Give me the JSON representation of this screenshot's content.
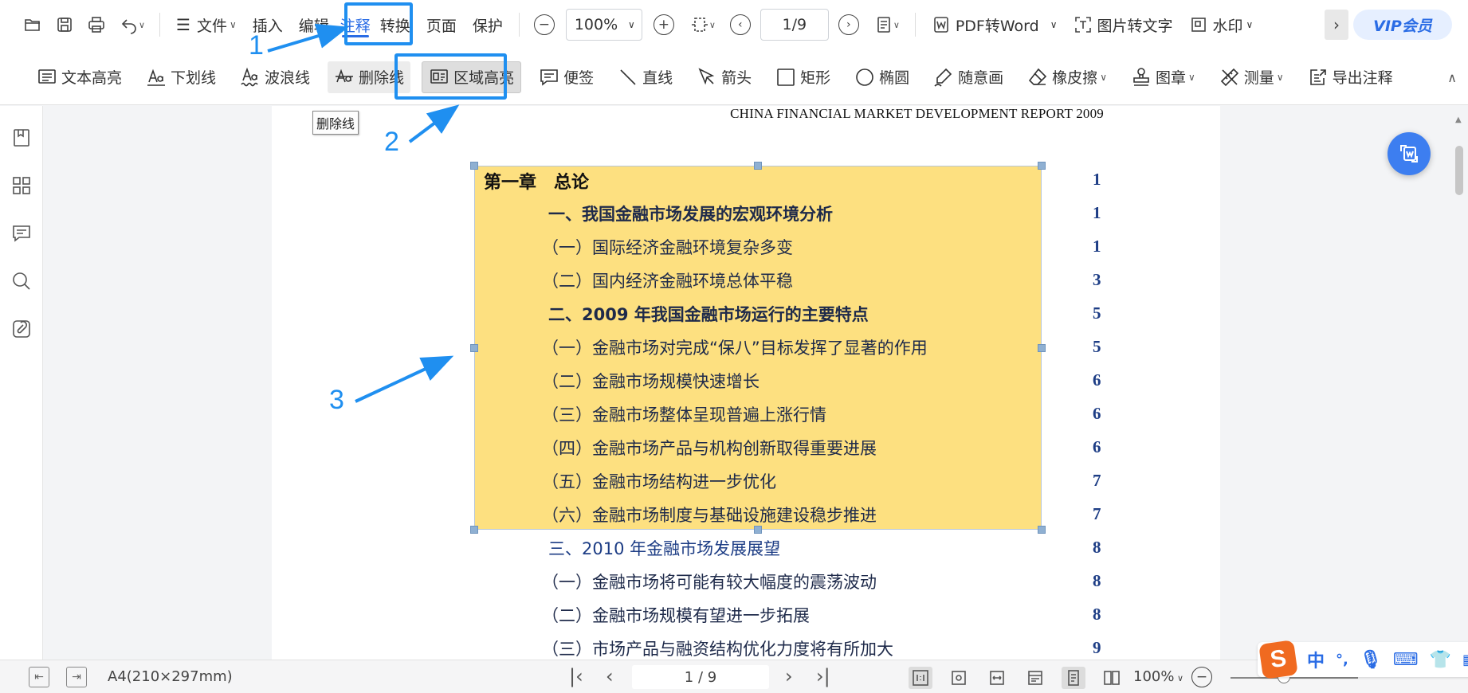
{
  "menubar": {
    "file": "文件",
    "tabs": [
      "插入",
      "编辑",
      "注释",
      "转换",
      "页面",
      "保护"
    ],
    "zoom": "100%",
    "page": "1/9",
    "pdf_to_word": "PDF转Word",
    "image_to_text": "图片转文字",
    "watermark": "水印",
    "vip": "VIP会员"
  },
  "toolbar": {
    "text_highlight": "文本高亮",
    "underline": "下划线",
    "wavy_line": "波浪线",
    "strikethrough": "删除线",
    "area_highlight": "区域高亮",
    "note": "便签",
    "line": "直线",
    "arrow": "箭头",
    "rectangle": "矩形",
    "ellipse": "椭圆",
    "freehand": "随意画",
    "eraser": "橡皮擦",
    "stamp": "图章",
    "measure": "测量",
    "export_notes": "导出注释"
  },
  "tooltip": "删除线",
  "document": {
    "header": "CHINA FINANCIAL MARKET DEVELOPMENT REPORT 2009",
    "toc": [
      {
        "text": "第一章　总论",
        "page": "1",
        "style": "chapter"
      },
      {
        "text": "一、我国金融市场发展的宏观环境分析",
        "page": "1",
        "style": "bold"
      },
      {
        "text": "（一）国际经济金融环境复杂多变",
        "page": "1",
        "style": "normal"
      },
      {
        "text": "（二）国内经济金融环境总体平稳",
        "page": "3",
        "style": "normal"
      },
      {
        "text": "二、2009 年我国金融市场运行的主要特点",
        "page": "5",
        "style": "bold"
      },
      {
        "text": "（一）金融市场对完成“保八”目标发挥了显著的作用",
        "page": "5",
        "style": "normal"
      },
      {
        "text": "（二）金融市场规模快速增长",
        "page": "6",
        "style": "normal"
      },
      {
        "text": "（三）金融市场整体呈现普遍上涨行情",
        "page": "6",
        "style": "normal"
      },
      {
        "text": "（四）金融市场产品与机构创新取得重要进展",
        "page": "6",
        "style": "normal"
      },
      {
        "text": "（五）金融市场结构进一步优化",
        "page": "7",
        "style": "normal"
      },
      {
        "text": "（六）金融市场制度与基础设施建设稳步推进",
        "page": "7",
        "style": "normal"
      },
      {
        "text": "三、2010 年金融市场发展展望",
        "page": "8",
        "style": "blue"
      },
      {
        "text": "（一）金融市场将可能有较大幅度的震荡波动",
        "page": "8",
        "style": "normal"
      },
      {
        "text": "（二）金融市场规模有望进一步拓展",
        "page": "8",
        "style": "normal"
      },
      {
        "text": "（三）市场产品与融资结构优化力度将有所加大",
        "page": "9",
        "style": "normal"
      }
    ]
  },
  "annotations": {
    "labels": [
      "1",
      "2",
      "3"
    ],
    "color": "#1f8ff0"
  },
  "statusbar": {
    "paper_size": "A4(210×297mm)",
    "page": "1 / 9",
    "zoom": "100%"
  },
  "ime": {
    "lang": "中",
    "punct": "°,"
  }
}
